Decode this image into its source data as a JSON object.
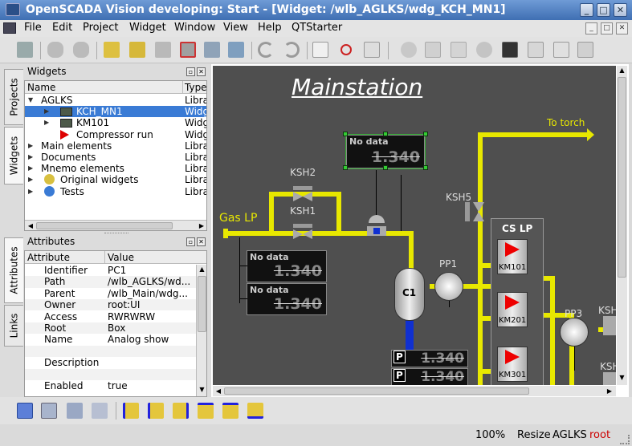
{
  "window": {
    "title": "OpenSCADA Vision developing: Start - [Widget: /wlb_AGLKS/wdg_KCH_MN1]",
    "controls": [
      "_",
      "□",
      "✕"
    ],
    "mdi_controls": [
      "_",
      "□",
      "✕"
    ]
  },
  "menu": [
    "File",
    "Edit",
    "Project",
    "Widget",
    "Window",
    "View",
    "Help",
    "QTStarter"
  ],
  "colors": {
    "accent": "#3a7bd5",
    "pipe": "#e8e800",
    "canvas": "#4f4f4f"
  },
  "left_tabs_top": [
    "Projects",
    "Widgets"
  ],
  "left_tabs_bottom": [
    "Attributes",
    "Links"
  ],
  "widgets_panel": {
    "title": "Widgets",
    "columns": [
      "Name",
      "Type"
    ],
    "rows": [
      {
        "indent": 0,
        "arrow": "▼",
        "icon": "",
        "name": "AGLKS",
        "type": "Libra",
        "selected": false
      },
      {
        "indent": 1,
        "arrow": "▶",
        "icon": "widget",
        "name": "KCH_MN1",
        "type": "Widg",
        "selected": true
      },
      {
        "indent": 1,
        "arrow": "▶",
        "icon": "widget",
        "name": "KM101",
        "type": "Widg",
        "selected": false
      },
      {
        "indent": 1,
        "arrow": "",
        "icon": "red-arrow",
        "name": "Compressor run",
        "type": "Widg",
        "selected": false
      },
      {
        "indent": 0,
        "arrow": "▶",
        "icon": "",
        "name": "Main elements",
        "type": "Libra",
        "selected": false
      },
      {
        "indent": 0,
        "arrow": "▶",
        "icon": "",
        "name": "Documents",
        "type": "Libra",
        "selected": false
      },
      {
        "indent": 0,
        "arrow": "▶",
        "icon": "",
        "name": "Mnemo elements",
        "type": "Libra",
        "selected": false
      },
      {
        "indent": 0,
        "arrow": "▶",
        "icon": "gear",
        "name": "Original widgets",
        "type": "Libra",
        "selected": false
      },
      {
        "indent": 0,
        "arrow": "▶",
        "icon": "help",
        "name": "Tests",
        "type": "Libra",
        "selected": false
      }
    ]
  },
  "attributes_panel": {
    "title": "Attributes",
    "columns": [
      "Attribute",
      "Value"
    ],
    "rows": [
      {
        "attr": "Identifier",
        "value": "PC1"
      },
      {
        "attr": "Path",
        "value": "/wlb_AGLKS/wd..."
      },
      {
        "attr": "Parent",
        "value": "/wlb_Main/wdg..."
      },
      {
        "attr": "Owner",
        "value": "root:UI"
      },
      {
        "attr": "Access",
        "value": "RWRWRW"
      },
      {
        "attr": "Root",
        "value": "Box"
      },
      {
        "attr": "Name",
        "value": "Analog show"
      },
      {
        "attr": "",
        "value": ""
      },
      {
        "attr": "Description",
        "value": ""
      },
      {
        "attr": "",
        "value": ""
      },
      {
        "attr": "Enabled",
        "value": "true"
      }
    ]
  },
  "mnemo": {
    "title": "Mainstation",
    "to_torch": "To torch",
    "gas_lp": "Gas LP",
    "ksh2": "KSH2",
    "ksh1": "KSH1",
    "ksh5": "KSH5",
    "cs_lp": "CS LP",
    "c1": "C1",
    "pp1": "PP1",
    "pp3": "PP3",
    "ksh_partial": "KSH",
    "ksh_partial2": "KSH",
    "km101": "KM101",
    "km201": "KM201",
    "km301": "KM301",
    "no_data": "No data",
    "value": "1.340",
    "p": "P"
  },
  "status": {
    "zoom": "100%",
    "mode": "Resize",
    "station": "AGLKS",
    "user": "root",
    "user_color": "#cc0000"
  }
}
